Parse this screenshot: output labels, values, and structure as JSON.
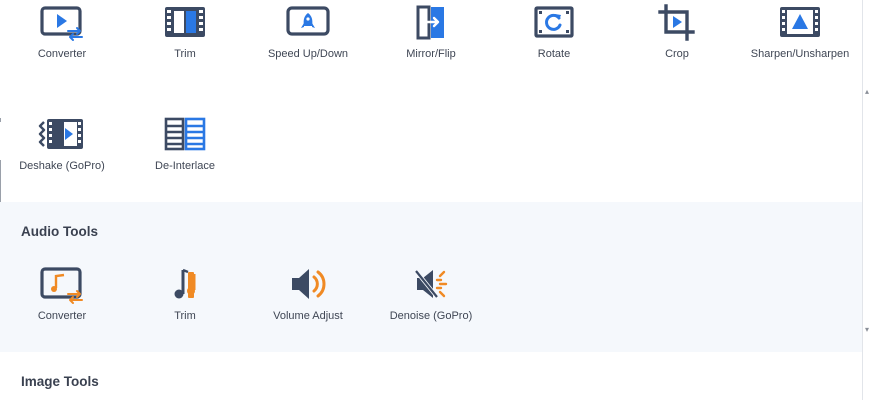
{
  "colors": {
    "primary_dark": "#3c4a63",
    "accent_blue": "#2a78e4",
    "accent_orange": "#f08a24",
    "audio_bg": "#f5f8fc"
  },
  "video_tools": {
    "items": [
      {
        "label": "Converter",
        "icon": "video-converter-icon"
      },
      {
        "label": "Trim",
        "icon": "film-trim-icon"
      },
      {
        "label": "Speed Up/Down",
        "icon": "rocket-speed-icon"
      },
      {
        "label": "Mirror/Flip",
        "icon": "mirror-flip-icon"
      },
      {
        "label": "Rotate",
        "icon": "rotate-icon"
      },
      {
        "label": "Crop",
        "icon": "crop-icon"
      },
      {
        "label": "Sharpen/Unsharpen",
        "icon": "sharpen-icon"
      },
      {
        "label": "Deshake (GoPro)",
        "icon": "deshake-icon"
      },
      {
        "label": "De-Interlace",
        "icon": "deinterlace-icon"
      }
    ]
  },
  "audio_tools": {
    "title": "Audio Tools",
    "items": [
      {
        "label": "Converter",
        "icon": "audio-converter-icon"
      },
      {
        "label": "Trim",
        "icon": "audio-trim-icon"
      },
      {
        "label": "Volume Adjust",
        "icon": "volume-icon"
      },
      {
        "label": "Denoise (GoPro)",
        "icon": "denoise-icon"
      }
    ]
  },
  "image_tools": {
    "title": "Image Tools"
  }
}
